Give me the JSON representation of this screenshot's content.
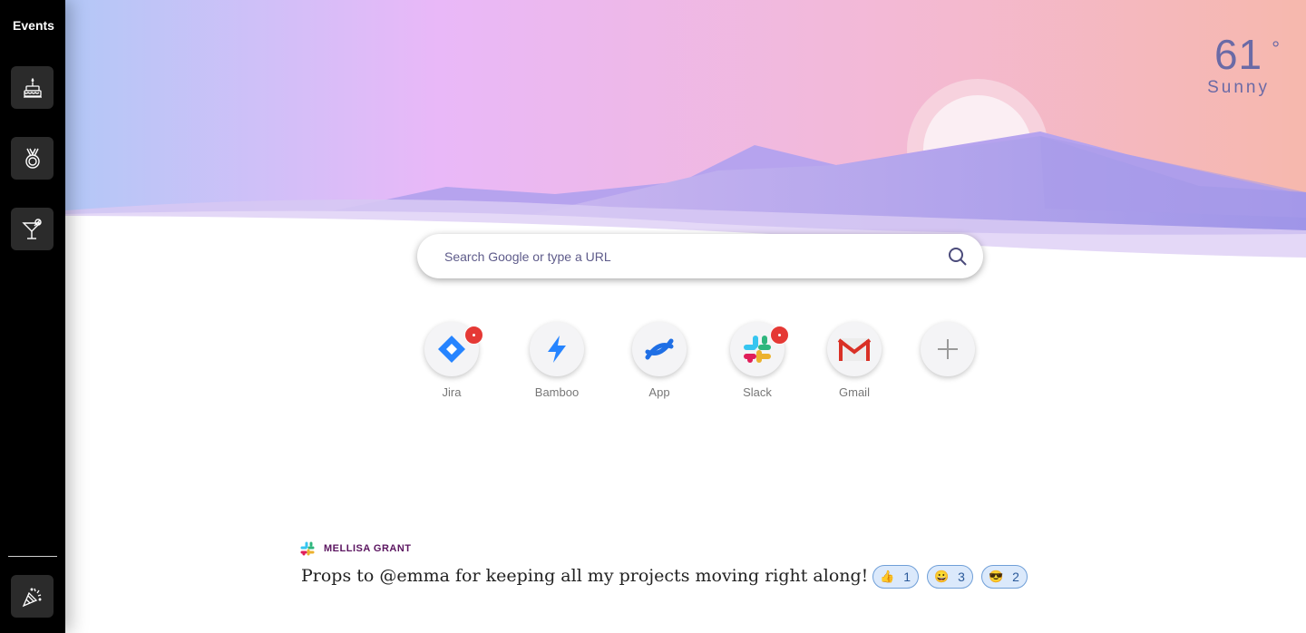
{
  "sidebar": {
    "title": "Events",
    "items": [
      {
        "icon": "birthday-cake-icon"
      },
      {
        "icon": "medal-icon"
      },
      {
        "icon": "cocktail-icon"
      }
    ],
    "bottom_item": {
      "icon": "party-popper-icon"
    }
  },
  "weather": {
    "temperature": "61",
    "degree_symbol": "°",
    "condition": "Sunny"
  },
  "search": {
    "placeholder": "Search Google or type a URL",
    "icon": "search-icon"
  },
  "shortcuts": [
    {
      "label": "Jira",
      "icon": "jira-icon",
      "badge": true
    },
    {
      "label": "Bamboo",
      "icon": "bamboo-icon",
      "badge": false
    },
    {
      "label": "App",
      "icon": "confluence-icon",
      "badge": false
    },
    {
      "label": "Slack",
      "icon": "slack-icon",
      "badge": true
    },
    {
      "label": "Gmail",
      "icon": "gmail-icon",
      "badge": false
    },
    {
      "label": "",
      "icon": "add-icon",
      "badge": false
    }
  ],
  "message": {
    "sender": "MELLISA GRANT",
    "text": "Props to @emma for keeping all my projects moving right along!",
    "reactions": [
      {
        "emoji": "👍",
        "count": "1"
      },
      {
        "emoji": "😀",
        "count": "3"
      },
      {
        "emoji": "😎",
        "count": "2"
      }
    ]
  },
  "colors": {
    "sidebar_bg": "#000000",
    "accent_purple": "#6a6aa6",
    "badge_red": "#e53935",
    "reaction_bg": "#dbe9fb"
  }
}
